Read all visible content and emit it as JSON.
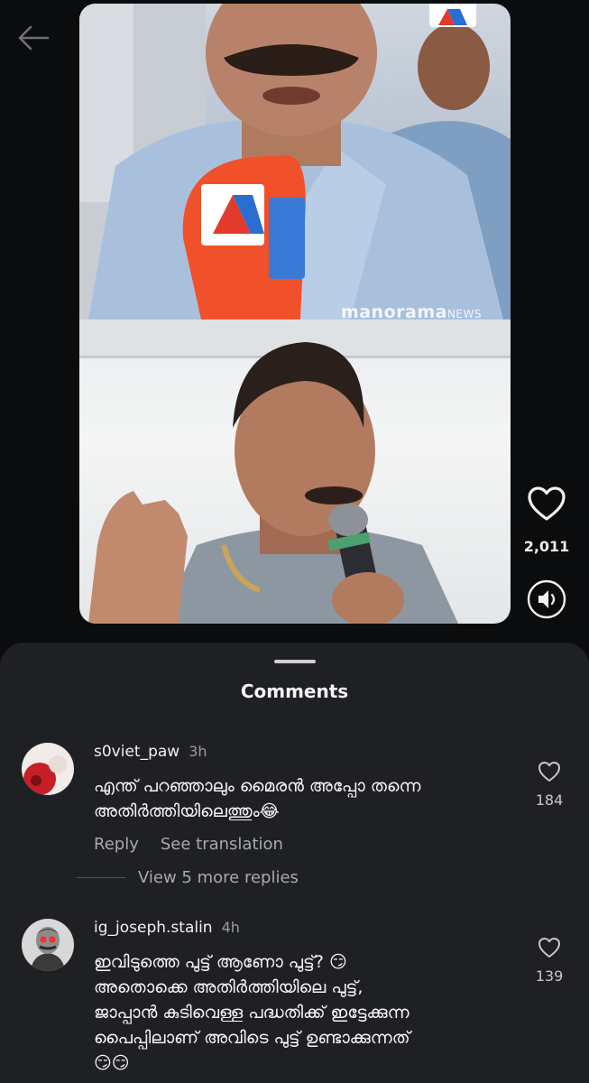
{
  "header": {
    "back_icon": "arrow-left-icon"
  },
  "video": {
    "watermark_brand": "manorama",
    "watermark_suffix": "NEWS",
    "likes": "2,011"
  },
  "comments_sheet": {
    "title": "Comments",
    "comments": [
      {
        "username": "s0viet_paw",
        "time": "3h",
        "text": "എന്ത് പറഞ്ഞാലും മൈരൻ അപ്പോ തന്നെ\nഅതിർത്തിയിലെത്തും😂",
        "likes": "184",
        "reply_label": "Reply",
        "translate_label": "See translation",
        "view_replies_label": "View 5 more replies"
      },
      {
        "username": "ig_joseph.stalin",
        "time": "4h",
        "text": "ഇവിടുത്തെ പുട്ട് ആണോ പുട്ട്? 😏\nഅതൊക്കെ അതിർത്തിയിലെ പുട്ട്,\nജാപ്പാൻ കുടിവെള്ള പദ്ധതിക്ക് ഇട്ടേക്കുന്ന\nപൈപ്പിലാണ് അവിടെ പുട്ട് ഉണ്ടാക്കുന്നത്\n😏😏",
        "likes": "139"
      }
    ]
  }
}
